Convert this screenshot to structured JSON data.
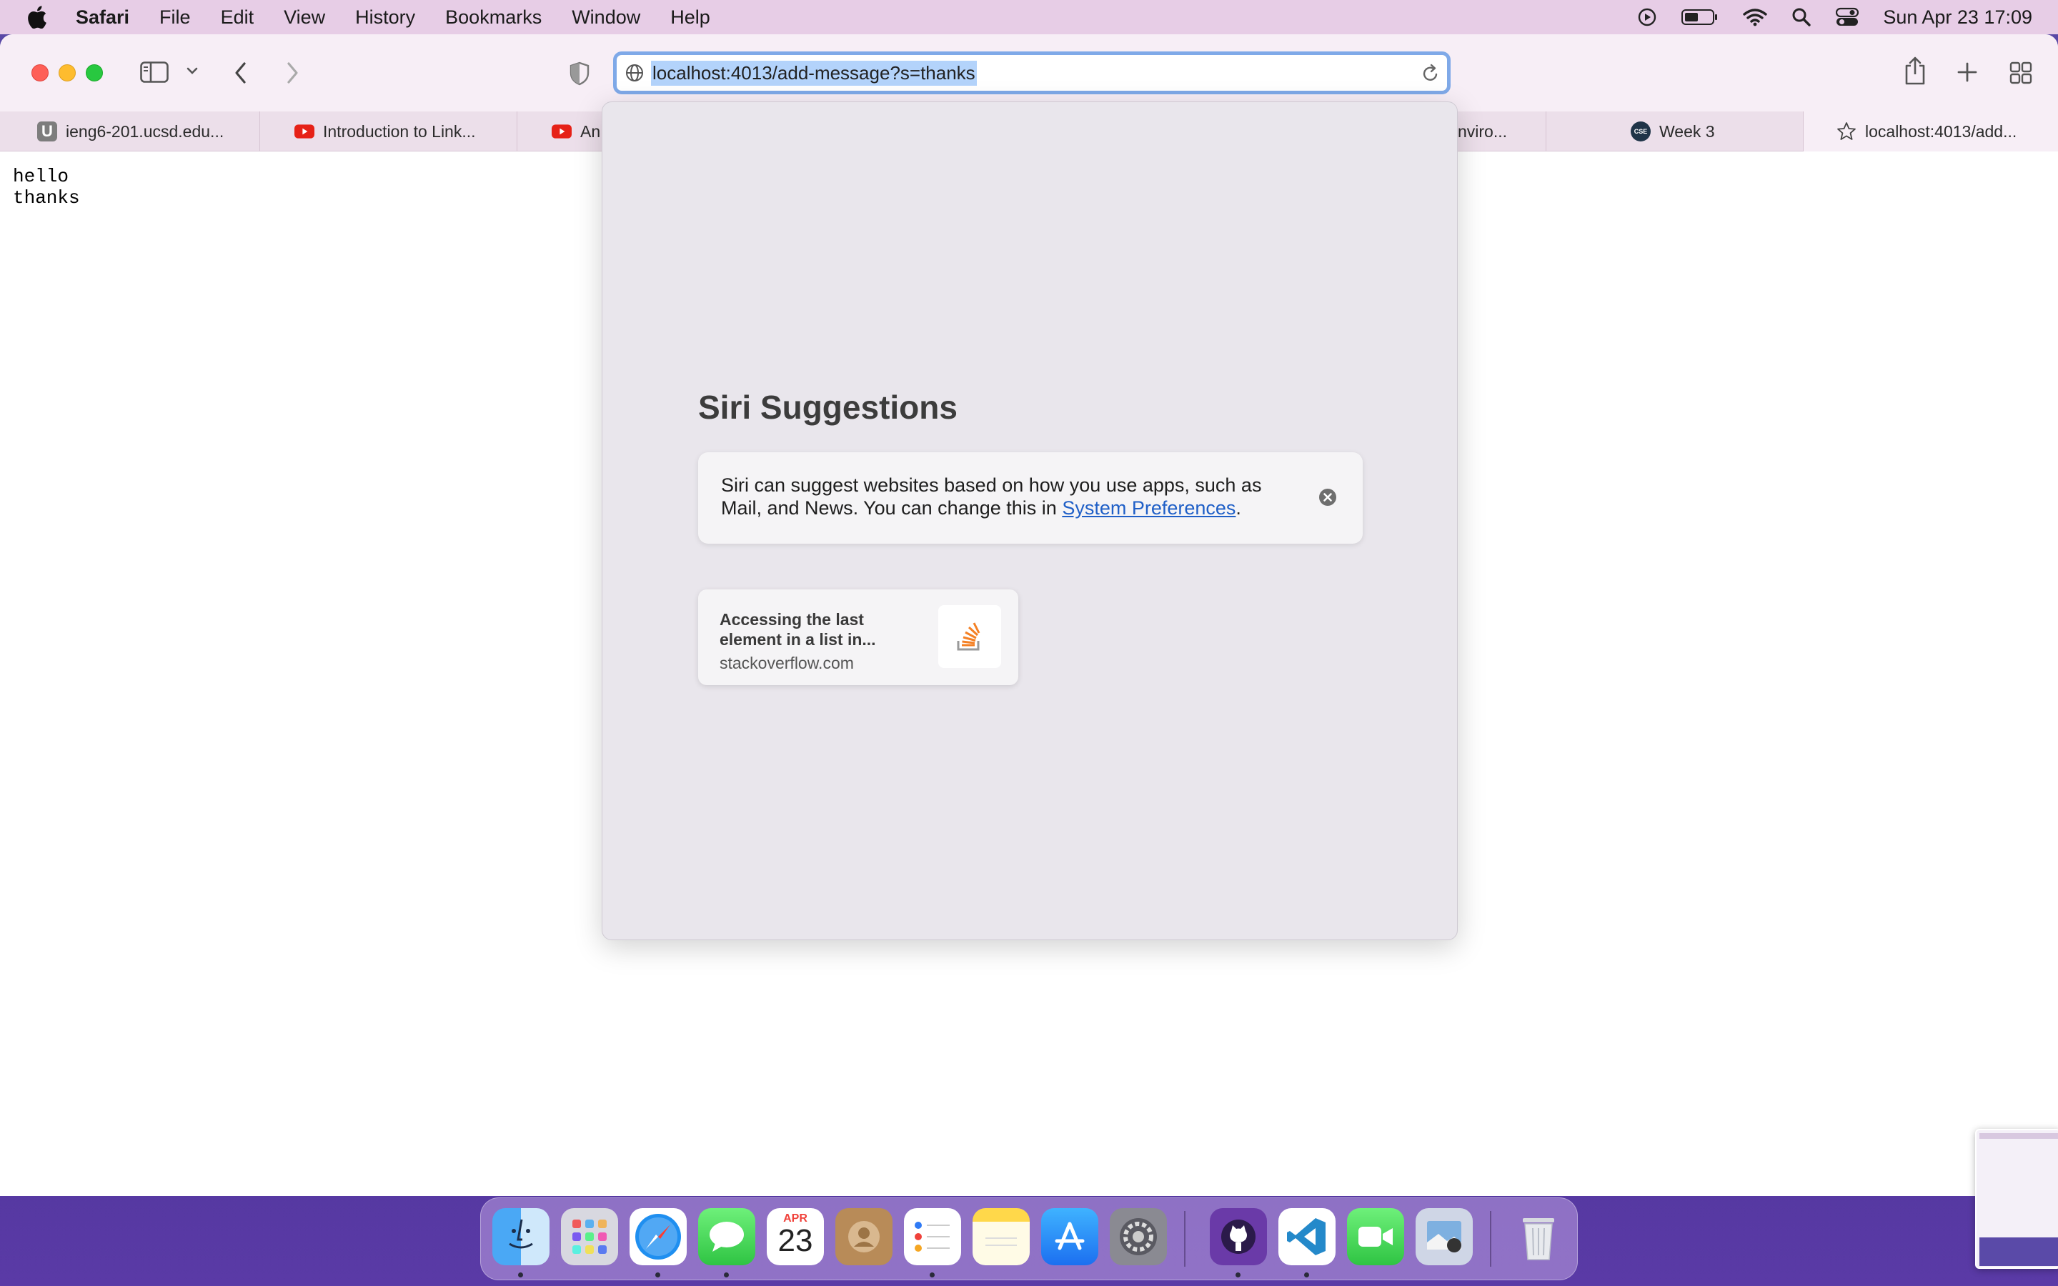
{
  "menubar": {
    "app": "Safari",
    "items": [
      "File",
      "Edit",
      "View",
      "History",
      "Bookmarks",
      "Window",
      "Help"
    ],
    "clock": "Sun Apr 23  17:09"
  },
  "toolbar": {
    "url": "localhost:4013/add-message?s=thanks"
  },
  "tabs": [
    {
      "label": "ieng6-201.ucsd.edu...",
      "icon": "u-favicon"
    },
    {
      "label": "Introduction to Link...",
      "icon": "youtube-favicon"
    },
    {
      "label": "An",
      "icon": "youtube-favicon"
    },
    {
      "label": "nviro...",
      "icon": "none"
    },
    {
      "label": "Week 3",
      "icon": "cse-favicon"
    },
    {
      "label": "localhost:4013/add...",
      "icon": "star-icon"
    }
  ],
  "page": {
    "lines": [
      "hello",
      "thanks"
    ]
  },
  "suggestions": {
    "heading": "Siri Suggestions",
    "notice_text": "Siri can suggest websites based on how you use apps, such as Mail, and News. You can change this in ",
    "notice_link": "System Preferences",
    "notice_end": ".",
    "card_title": "Accessing the last element in a list in...",
    "card_url": "stackoverflow.com"
  },
  "dock": {
    "calendar_month": "APR",
    "calendar_day": "23",
    "apps": [
      "Finder",
      "Launchpad",
      "Safari",
      "Messages",
      "Calendar",
      "Contacts",
      "Reminders",
      "Notes",
      "App Store",
      "System Preferences",
      "GitHub Desktop",
      "Visual Studio Code",
      "FaceTime",
      "Preview",
      "Trash"
    ]
  },
  "colors": {
    "menubar": "#e7cde6",
    "toolbar": "#f7eef6",
    "url_focus": "#7fa9e8",
    "link": "#1f5fc7"
  }
}
